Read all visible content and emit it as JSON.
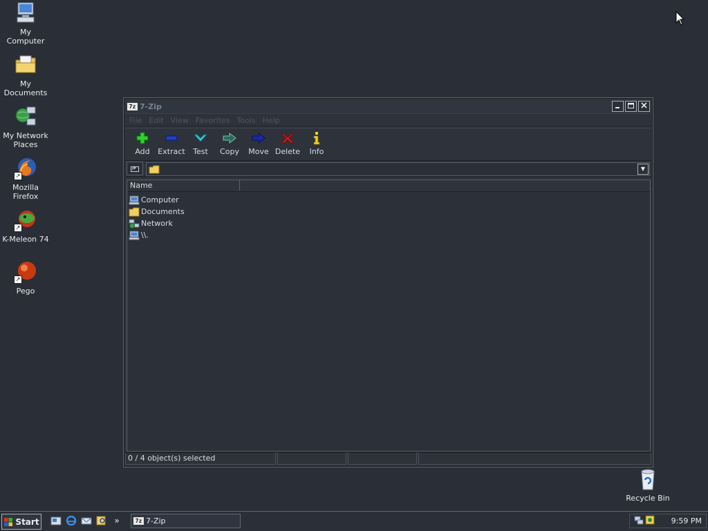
{
  "desktop": {
    "icons": [
      {
        "label": "My Computer"
      },
      {
        "label": "My Documents"
      },
      {
        "label": "My Network Places"
      },
      {
        "label": "Mozilla Firefox"
      },
      {
        "label": "K-Meleon 74"
      },
      {
        "label": "Pego"
      },
      {
        "label": "Recycle Bin"
      }
    ]
  },
  "window": {
    "title": "7-Zip",
    "app_icon_text": "7z",
    "menu": [
      "File",
      "Edit",
      "View",
      "Favorites",
      "Tools",
      "Help"
    ],
    "toolbar": [
      {
        "label": "Add",
        "icon": "add-icon"
      },
      {
        "label": "Extract",
        "icon": "extract-icon"
      },
      {
        "label": "Test",
        "icon": "test-icon"
      },
      {
        "label": "Copy",
        "icon": "copy-icon"
      },
      {
        "label": "Move",
        "icon": "move-icon"
      },
      {
        "label": "Delete",
        "icon": "delete-icon"
      },
      {
        "label": "Info",
        "icon": "info-icon"
      }
    ],
    "address": {
      "value": ""
    },
    "list": {
      "columns": [
        "Name"
      ],
      "rows": [
        {
          "name": "Computer",
          "icon": "computer-icon"
        },
        {
          "name": "Documents",
          "icon": "folder-icon"
        },
        {
          "name": "Network",
          "icon": "network-icon"
        },
        {
          "name": "\\\\.",
          "icon": "computer-icon"
        }
      ]
    },
    "status": {
      "selection": "0 / 4 object(s) selected"
    }
  },
  "taskbar": {
    "start_label": "Start",
    "chevron": "»",
    "task_label": "7-Zip",
    "task_icon_text": "7z",
    "clock": "9:59 PM"
  },
  "colors": {
    "desktop_bg": "#2a2e36",
    "window_bg": "#2e333b",
    "add_green": "#2fd02f",
    "delete_red": "#e02020",
    "info_yellow": "#e8d020"
  }
}
